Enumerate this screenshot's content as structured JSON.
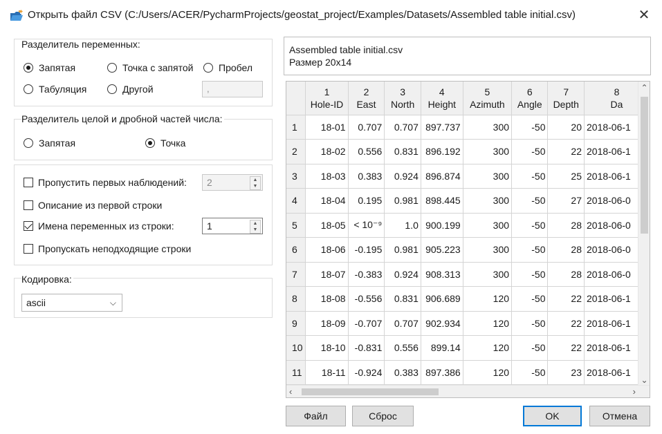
{
  "window": {
    "title": "Открыть файл CSV (C:/Users/ACER/PycharmProjects/geostat_project/Examples/Datasets/Assembled table initial.csv)",
    "close": "✕"
  },
  "var_separator": {
    "label": "Разделитель переменных:",
    "options": [
      "Запятая",
      "Точка с запятой",
      "Пробел",
      "Табуляция",
      "Другой"
    ],
    "selected": "Запятая",
    "other_value": ","
  },
  "decimal_separator": {
    "label": "Разделитель целой и дробной частей числа:",
    "options": [
      "Запятая",
      "Точка"
    ],
    "selected": "Точка"
  },
  "options": {
    "skip_first": {
      "label": "Пропустить первых наблюдений:",
      "checked": false,
      "value": "2"
    },
    "desc_first_row": {
      "label": "Описание из первой строки",
      "checked": false
    },
    "names_from_row": {
      "label": "Имена переменных из строки:",
      "checked": true,
      "value": "1"
    },
    "skip_bad_rows": {
      "label": "Пропускать неподходящие строки",
      "checked": false
    }
  },
  "encoding": {
    "label": "Кодировка:",
    "value": "ascii"
  },
  "file_info": {
    "name": "Assembled table initial.csv",
    "size": "Размер 20x14"
  },
  "table": {
    "columns": [
      {
        "num": "1",
        "name": "Hole-ID"
      },
      {
        "num": "2",
        "name": "East"
      },
      {
        "num": "3",
        "name": "North"
      },
      {
        "num": "4",
        "name": "Height"
      },
      {
        "num": "5",
        "name": "Azimuth"
      },
      {
        "num": "6",
        "name": "Angle"
      },
      {
        "num": "7",
        "name": "Depth"
      },
      {
        "num": "8",
        "name": "Da"
      }
    ],
    "rows": [
      {
        "n": "1",
        "cells": [
          "18-01",
          "0.707",
          "0.707",
          "897.737",
          "300",
          "-50",
          "20",
          "2018-06-1"
        ]
      },
      {
        "n": "2",
        "cells": [
          "18-02",
          "0.556",
          "0.831",
          "896.192",
          "300",
          "-50",
          "22",
          "2018-06-1"
        ]
      },
      {
        "n": "3",
        "cells": [
          "18-03",
          "0.383",
          "0.924",
          "896.874",
          "300",
          "-50",
          "25",
          "2018-06-1"
        ]
      },
      {
        "n": "4",
        "cells": [
          "18-04",
          "0.195",
          "0.981",
          "898.445",
          "300",
          "-50",
          "27",
          "2018-06-0"
        ]
      },
      {
        "n": "5",
        "cells": [
          "18-05",
          "< 10⁻⁹",
          "1.0",
          "900.199",
          "300",
          "-50",
          "28",
          "2018-06-0"
        ]
      },
      {
        "n": "6",
        "cells": [
          "18-06",
          "-0.195",
          "0.981",
          "905.223",
          "300",
          "-50",
          "28",
          "2018-06-0"
        ]
      },
      {
        "n": "7",
        "cells": [
          "18-07",
          "-0.383",
          "0.924",
          "908.313",
          "300",
          "-50",
          "28",
          "2018-06-0"
        ]
      },
      {
        "n": "8",
        "cells": [
          "18-08",
          "-0.556",
          "0.831",
          "906.689",
          "120",
          "-50",
          "22",
          "2018-06-1"
        ]
      },
      {
        "n": "9",
        "cells": [
          "18-09",
          "-0.707",
          "0.707",
          "902.934",
          "120",
          "-50",
          "22",
          "2018-06-1"
        ]
      },
      {
        "n": "10",
        "cells": [
          "18-10",
          "-0.831",
          "0.556",
          "899.14",
          "120",
          "-50",
          "22",
          "2018-06-1"
        ]
      },
      {
        "n": "11",
        "cells": [
          "18-11",
          "-0.924",
          "0.383",
          "897.386",
          "120",
          "-50",
          "23",
          "2018-06-1"
        ]
      }
    ]
  },
  "buttons": {
    "file": "Файл",
    "reset": "Сброс",
    "ok": "OK",
    "cancel": "Отмена"
  },
  "icons": {
    "title": "folder-open-icon",
    "close": "close-icon"
  },
  "colors": {
    "accent": "#0078d7",
    "header_bg": "#f0f0f0",
    "button_bg": "#e1e1e1"
  }
}
